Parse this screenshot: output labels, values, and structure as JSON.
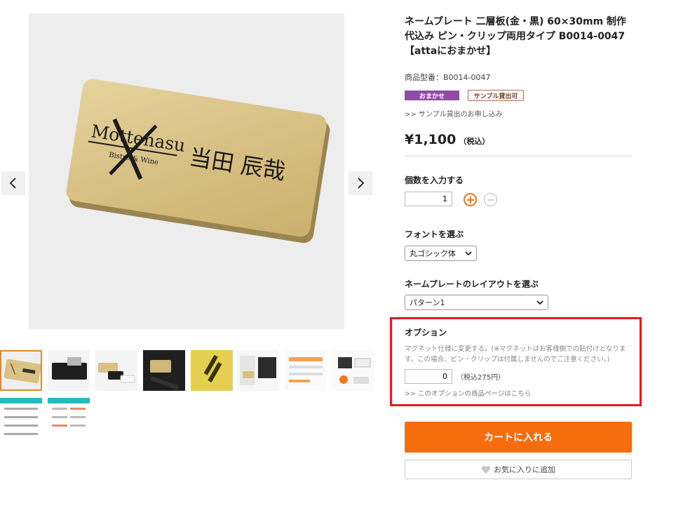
{
  "product": {
    "title": "ネームプレート 二層板(金・黒) 60×30mm 制作代込み ピン・クリップ両用タイプ B0014-0047【attaにおまかせ】",
    "sku": "商品型番：B0014-0047",
    "badges": {
      "omakase": "おまかせ",
      "sample": "サンプル貸出可"
    },
    "sample_link": ">> サンプル貸出のお申し込み",
    "price": "¥1,100",
    "price_tax": "（税込）"
  },
  "plate_image": {
    "logo_text": "Mottenasu",
    "logo_sub": "Bistro & Wine",
    "name_text": "当田 辰哉"
  },
  "quantity": {
    "label": "個数を入力する",
    "value": "1"
  },
  "font": {
    "label": "フォントを選ぶ",
    "selected": "丸ゴシック体"
  },
  "layout": {
    "label": "ネームプレートのレイアウトを選ぶ",
    "selected": "パターン1"
  },
  "option": {
    "title": "オプション",
    "description": "マグネット仕様に変更する。(※マグネットはお客様側での貼付けとなります。この場合、ピン・クリップは付属しませんのでご注意ください。)",
    "value": "0",
    "price": "（税込275円）",
    "link": ">> このオプションの商品ページはこちら"
  },
  "cart_button": "カートに入れる",
  "favorite_button": "お気に入りに追加",
  "icons": {
    "prev": "chevron-left-icon",
    "next": "chevron-right-icon",
    "plus": "plus-circle-icon",
    "minus": "minus-circle-icon",
    "select": "chevron-down-icon",
    "heart": "heart-icon"
  },
  "colors": {
    "accent_orange": "#f76c0c",
    "badge_purple": "#8e4ca7",
    "highlight_red": "#e31b23",
    "plate_gold": "#dcc68c"
  }
}
